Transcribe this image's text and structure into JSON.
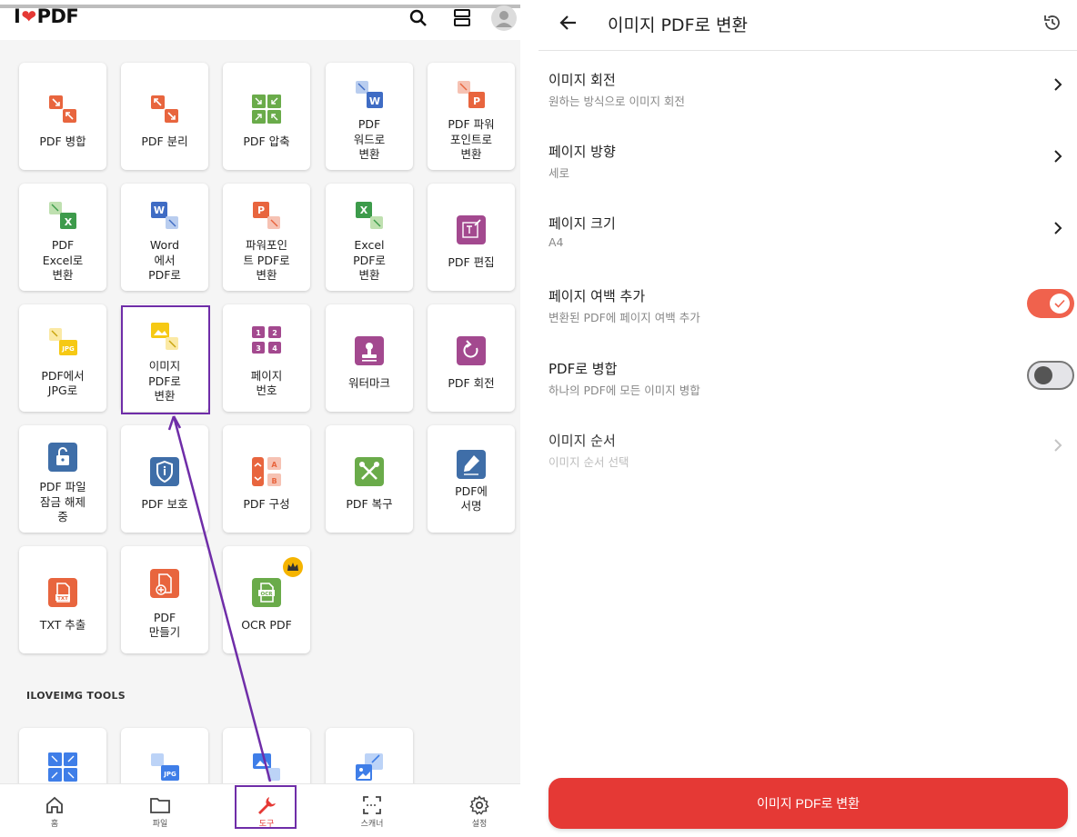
{
  "left": {
    "logo": {
      "prefix": "I",
      "suffix": "PDF"
    },
    "tools": [
      {
        "label": "PDF 병합"
      },
      {
        "label": "PDF 분리"
      },
      {
        "label": "PDF 압축"
      },
      {
        "label": "PDF\n워드로\n변환"
      },
      {
        "label": "PDF 파워\n포인트로\n변환"
      },
      {
        "label": "PDF\nExcel로\n변환"
      },
      {
        "label": "Word\n에서\nPDF로"
      },
      {
        "label": "파워포인\n트 PDF로\n변환"
      },
      {
        "label": "Excel\nPDF로\n변환"
      },
      {
        "label": "PDF 편집"
      },
      {
        "label": "PDF에서\nJPG로"
      },
      {
        "label": "이미지\nPDF로\n변환"
      },
      {
        "label": "페이지\n번호"
      },
      {
        "label": "워터마크"
      },
      {
        "label": "PDF 회전"
      },
      {
        "label": "PDF 파일\n잠금 해제\n중"
      },
      {
        "label": "PDF 보호"
      },
      {
        "label": "PDF 구성"
      },
      {
        "label": "PDF 복구"
      },
      {
        "label": "PDF에\n서명"
      },
      {
        "label": "TXT 추출"
      },
      {
        "label": "PDF\n만들기"
      },
      {
        "label": "OCR PDF"
      }
    ],
    "section_label": "ILOVEIMG TOOLS",
    "nav": [
      {
        "label": "홈"
      },
      {
        "label": "파일"
      },
      {
        "label": "도구"
      },
      {
        "label": "스캐너"
      },
      {
        "label": "설정"
      }
    ],
    "colors": {
      "accent": "#e53935",
      "highlight": "#6f2da8"
    }
  },
  "right": {
    "title": "이미지 PDF로 변환",
    "rows": [
      {
        "main": "이미지 회전",
        "sub": "원하는 방식으로 이미지 회전"
      },
      {
        "main": "페이지 방향",
        "sub": "세로"
      },
      {
        "main": "페이지 크기",
        "sub": "A4"
      },
      {
        "main": "페이지 여백 추가",
        "sub": "변환된 PDF에 페이지 여백 추가",
        "toggle": "on"
      },
      {
        "main": "PDF로 병합",
        "sub": "하나의 PDF에 모든 이미지 병합",
        "toggle": "off"
      },
      {
        "main": "이미지 순서",
        "sub": "이미지 순서 선택"
      }
    ],
    "cta": "이미지 PDF로 변환"
  }
}
